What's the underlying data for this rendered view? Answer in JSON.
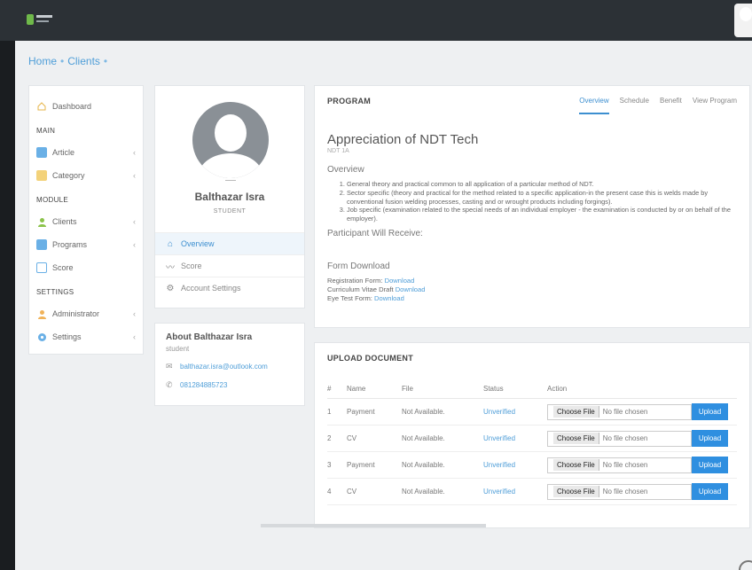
{
  "breadcrumb": {
    "home": "Home",
    "clients": "Clients"
  },
  "sidebar": {
    "dashboard": "Dashboard",
    "main_heading": "MAIN",
    "article": "Article",
    "category": "Category",
    "module_heading": "MODULE",
    "clients": "Clients",
    "programs": "Programs",
    "score": "Score",
    "settings_heading": "SETTINGS",
    "administrator": "Administrator",
    "settings": "Settings"
  },
  "profile": {
    "name": "Balthazar Isra",
    "role": "STUDENT",
    "menu": {
      "overview": "Overview",
      "score": "Score",
      "account_settings": "Account Settings"
    }
  },
  "about": {
    "title": "About Balthazar Isra",
    "subtitle": "student",
    "email": "balthazar.isra@outlook.com",
    "phone": "081284885723"
  },
  "program": {
    "heading": "PROGRAM",
    "tabs": {
      "overview": "Overview",
      "schedule": "Schedule",
      "benefit": "Benefit",
      "view_program": "View Program"
    },
    "course_name": "Appreciation of NDT Tech",
    "course_code": "NDT 1A",
    "overview_heading": "Overview",
    "overview_items": [
      "General theory and practical common to all application of a particular method of NDT.",
      "Sector specific (theory and practical for the method related to a specific application-in the present case this is welds made by conventional fusion welding processes, casting and or wrought products including forgings).",
      "Job specific (examination related to the special needs of an individual employer - the examination is conducted by or on behalf of the employer)."
    ],
    "participant_heading": "Participant Will Receive:",
    "form_heading": "Form Download",
    "forms": [
      {
        "label": "Registration Form:",
        "link": "Download"
      },
      {
        "label": "Curriculum Vitae Draft",
        "link": "Download"
      },
      {
        "label": "Eye Test Form:",
        "link": "Download"
      }
    ]
  },
  "upload": {
    "heading": "UPLOAD DOCUMENT",
    "columns": {
      "num": "#",
      "name": "Name",
      "file": "File",
      "status": "Status",
      "action": "Action"
    },
    "choose_file": "Choose File",
    "no_file": "No file chosen",
    "upload_label": "Upload",
    "rows": [
      {
        "num": "1",
        "name": "Payment",
        "file": "Not Available.",
        "status": "Unverified"
      },
      {
        "num": "2",
        "name": "CV",
        "file": "Not Available.",
        "status": "Unverified"
      },
      {
        "num": "3",
        "name": "Payment",
        "file": "Not Available.",
        "status": "Unverified"
      },
      {
        "num": "4",
        "name": "CV",
        "file": "Not Available.",
        "status": "Unverified"
      }
    ]
  },
  "colors": {
    "accent": "#3d8fd0",
    "upload_button": "#2f8fe0",
    "topbar": "#2c3136"
  }
}
